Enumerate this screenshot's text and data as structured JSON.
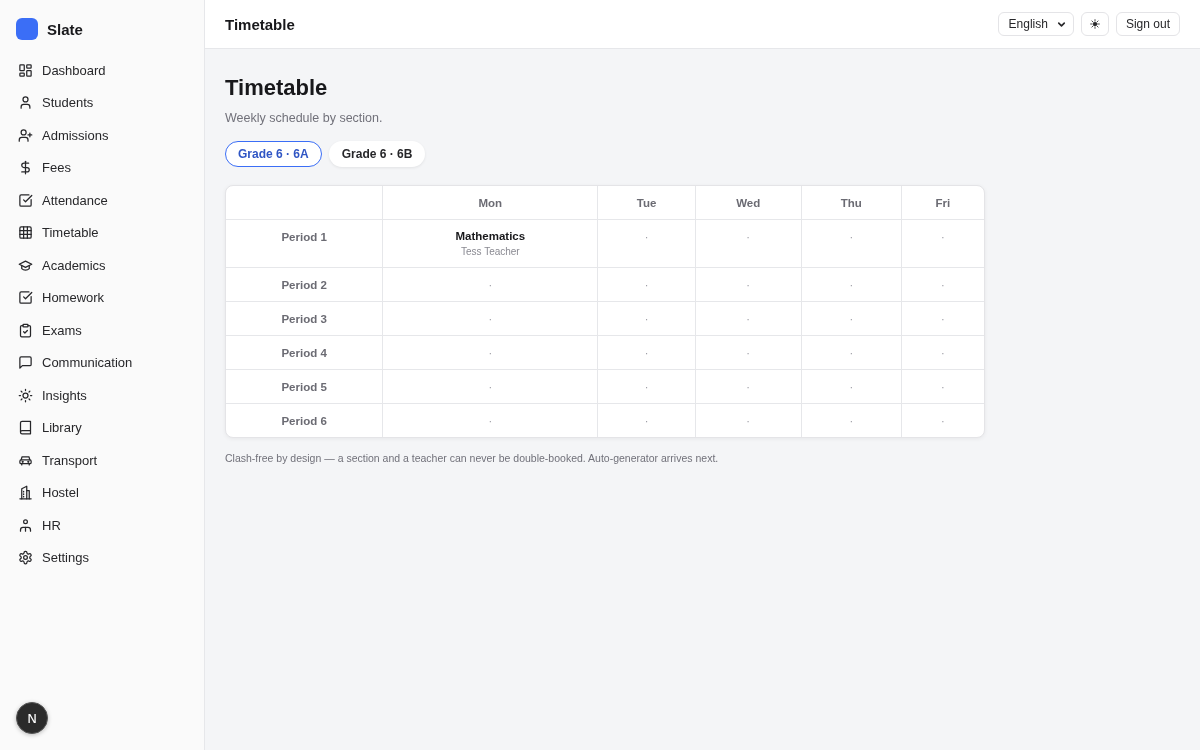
{
  "sidebar": {
    "brand": {
      "name": "Slate"
    },
    "items": [
      {
        "label": "Dashboard"
      },
      {
        "label": "Students"
      },
      {
        "label": "Admissions"
      },
      {
        "label": "Fees"
      },
      {
        "label": "Attendance"
      },
      {
        "label": "Timetable"
      },
      {
        "label": "Academics"
      },
      {
        "label": "Homework"
      },
      {
        "label": "Exams"
      },
      {
        "label": "Communication"
      },
      {
        "label": "Insights"
      },
      {
        "label": "Library"
      },
      {
        "label": "Transport"
      },
      {
        "label": "Hostel"
      },
      {
        "label": "HR"
      },
      {
        "label": "Settings"
      }
    ],
    "dev_badge": {
      "label": "N"
    }
  },
  "topbar": {
    "title": "Timetable",
    "language": {
      "value": "English"
    },
    "sign_out": {
      "label": "Sign out"
    }
  },
  "page": {
    "title": "Timetable",
    "subtitle": "Weekly schedule by section."
  },
  "section_tabs": [
    {
      "label": "Grade 6 · 6A",
      "selected": true
    },
    {
      "label": "Grade 6 · 6B",
      "selected": false
    }
  ],
  "table": {
    "columns": [
      "Mon",
      "Tue",
      "Wed",
      "Thu",
      "Fri"
    ],
    "rows": [
      {
        "period": "Period 1",
        "cells": [
          {
            "kind": "lesson",
            "subject": "Mathematics",
            "teacher": "Tess Teacher"
          },
          {
            "kind": "empty",
            "text": "·"
          },
          {
            "kind": "empty",
            "text": "·"
          },
          {
            "kind": "empty",
            "text": "·"
          },
          {
            "kind": "empty",
            "text": "·"
          }
        ]
      },
      {
        "period": "Period 2",
        "cells": [
          {
            "kind": "empty",
            "text": "·"
          },
          {
            "kind": "empty",
            "text": "·"
          },
          {
            "kind": "empty",
            "text": "·"
          },
          {
            "kind": "empty",
            "text": "·"
          },
          {
            "kind": "empty",
            "text": "·"
          }
        ]
      },
      {
        "period": "Period 3",
        "cells": [
          {
            "kind": "empty",
            "text": "·"
          },
          {
            "kind": "empty",
            "text": "·"
          },
          {
            "kind": "empty",
            "text": "·"
          },
          {
            "kind": "empty",
            "text": "·"
          },
          {
            "kind": "empty",
            "text": "·"
          }
        ]
      },
      {
        "period": "Period 4",
        "cells": [
          {
            "kind": "empty",
            "text": "·"
          },
          {
            "kind": "empty",
            "text": "·"
          },
          {
            "kind": "empty",
            "text": "·"
          },
          {
            "kind": "empty",
            "text": "·"
          },
          {
            "kind": "empty",
            "text": "·"
          }
        ]
      },
      {
        "period": "Period 5",
        "cells": [
          {
            "kind": "empty",
            "text": "·"
          },
          {
            "kind": "empty",
            "text": "·"
          },
          {
            "kind": "empty",
            "text": "·"
          },
          {
            "kind": "empty",
            "text": "·"
          },
          {
            "kind": "empty",
            "text": "·"
          }
        ]
      },
      {
        "period": "Period 6",
        "cells": [
          {
            "kind": "empty",
            "text": "·"
          },
          {
            "kind": "empty",
            "text": "·"
          },
          {
            "kind": "empty",
            "text": "·"
          },
          {
            "kind": "empty",
            "text": "·"
          },
          {
            "kind": "empty",
            "text": "·"
          }
        ]
      }
    ]
  },
  "footnote": "Clash-free by design — a section and a teacher can never be double-booked. Auto-generator arrives next."
}
